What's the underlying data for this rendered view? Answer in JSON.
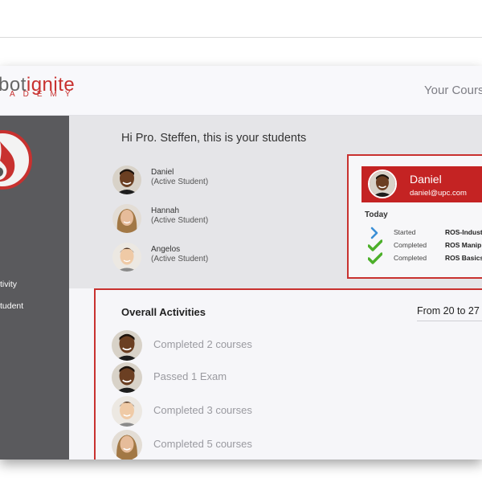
{
  "header": {
    "logo_prefix": "bot",
    "logo_suffix": "ignite",
    "logo_sub": "ADEMY",
    "title": "Your Cours"
  },
  "sidebar": {
    "items": [
      {
        "label": "tivity"
      },
      {
        "label": "tudent"
      }
    ]
  },
  "main": {
    "greeting": "Hi  Pro. Steffen, this is your students"
  },
  "students": [
    {
      "name": "Daniel",
      "status": "(Active Student)"
    },
    {
      "name": "Hannah",
      "status": "(Active Student)"
    },
    {
      "name": "Angelos",
      "status": "(Active Student)"
    }
  ],
  "detail": {
    "name": "Daniel",
    "email": "daniel@upc.com",
    "today_label": "Today",
    "activities": [
      {
        "icon": "chevron-right-icon",
        "status": "Started",
        "course": "ROS-Industr"
      },
      {
        "icon": "check-icon",
        "status": "Completed",
        "course": "ROS Manip"
      },
      {
        "icon": "check-icon",
        "status": "Completed",
        "course": "ROS Basics"
      }
    ]
  },
  "overall": {
    "title": "Overall Activities",
    "range": "From 20 to 27 (",
    "items": [
      {
        "text": "Completed 2 courses"
      },
      {
        "text": "Passed 1 Exam"
      },
      {
        "text": "Completed 3 courses"
      },
      {
        "text": "Completed 5 courses"
      }
    ]
  },
  "colors": {
    "brand_red": "#c8312f",
    "sidebar_bg": "#5a5a5d",
    "check_green": "#4caf2a",
    "chevron_blue": "#3b8fd6"
  }
}
